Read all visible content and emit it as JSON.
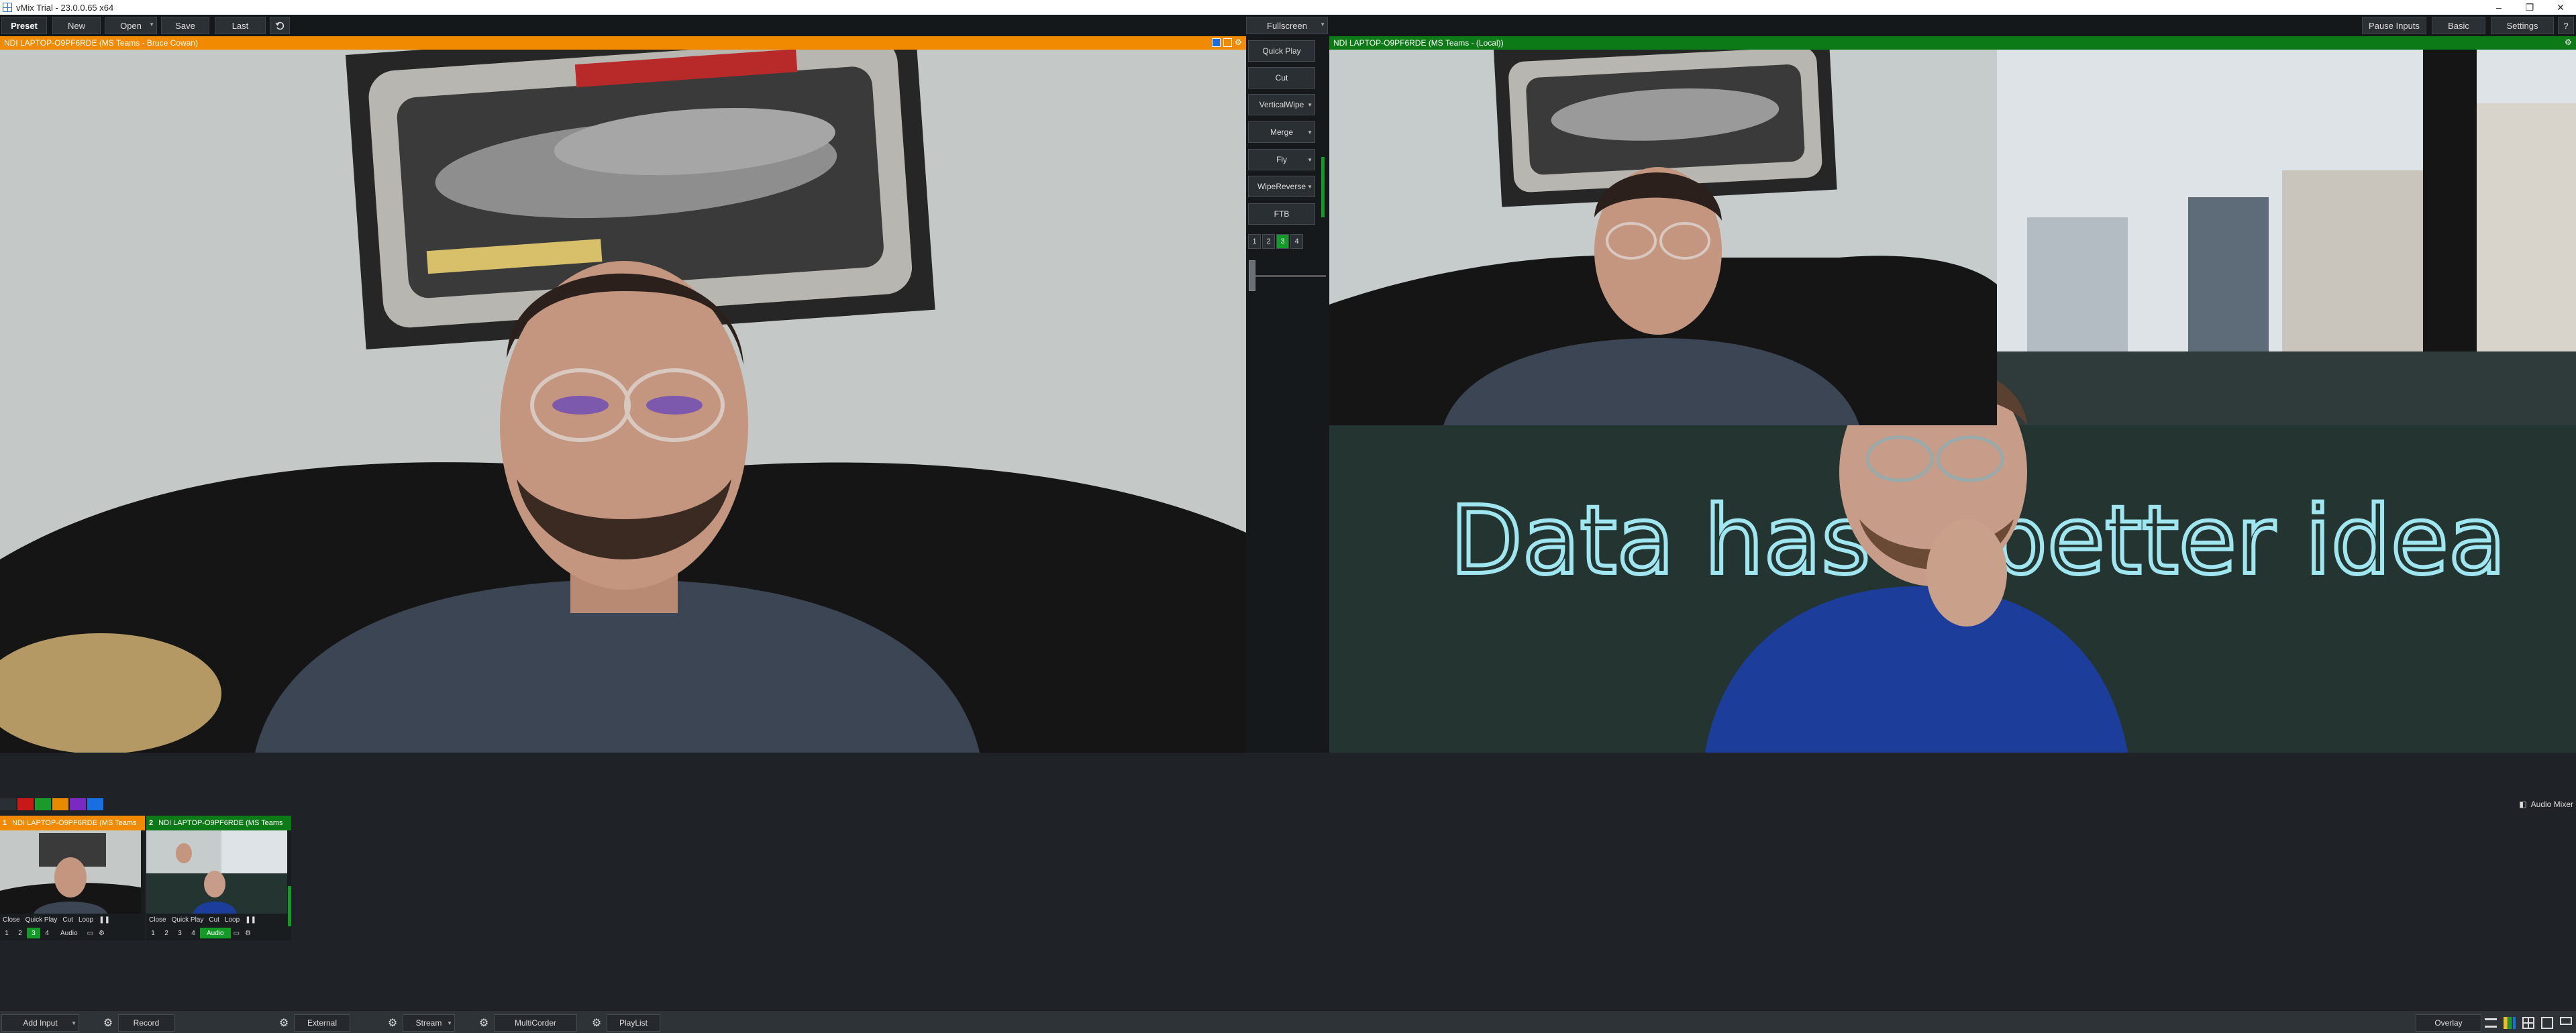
{
  "window": {
    "title": "vMix Trial - 23.0.0.65 x64",
    "minimize": "–",
    "maximize": "❐",
    "close": "✕"
  },
  "toolbar": {
    "preset": "Preset",
    "new": "New",
    "open": "Open",
    "save": "Save",
    "last": "Last",
    "undo_icon": "undo-icon",
    "fullscreen": "Fullscreen",
    "pause_inputs": "Pause Inputs",
    "basic": "Basic",
    "settings": "Settings",
    "help": "?"
  },
  "preview": {
    "title": "NDI LAPTOP-O9PF6RDE (MS Teams - Bruce Cowan)",
    "accent": "#f28a00"
  },
  "program": {
    "title": "NDI LAPTOP-O9PF6RDE (MS Teams - (Local))",
    "accent": "#0c7a16",
    "neon_text": "Data has a better idea"
  },
  "transitions": {
    "quick_play": "Quick Play",
    "cut": "Cut",
    "t1": "VerticalWipe",
    "t2": "Merge",
    "t3": "Fly",
    "t4": "WipeReverse",
    "ftb": "FTB",
    "numbers": [
      "1",
      "2",
      "3",
      "4"
    ],
    "active_number": "3"
  },
  "color_tags": [
    "#c81818",
    "#1a9a2a",
    "#e88a00",
    "#7a2ac0",
    "#1a6fe0",
    "#1aa0e8"
  ],
  "inputs": [
    {
      "number": "1",
      "title": "NDI LAPTOP-O9PF6RDE (MS Teams",
      "state": "preview",
      "close": "Close",
      "quick_play": "Quick Play",
      "cut": "Cut",
      "loop": "Loop",
      "n1": "1",
      "n2": "2",
      "n3": "3",
      "n4": "4",
      "audio": "Audio",
      "active_number": "3"
    },
    {
      "number": "2",
      "title": "NDI LAPTOP-O9PF6RDE (MS Teams",
      "state": "program",
      "close": "Close",
      "quick_play": "Quick Play",
      "cut": "Cut",
      "loop": "Loop",
      "n1": "1",
      "n2": "2",
      "n3": "3",
      "n4": "4",
      "audio": "Audio",
      "audio_on": true
    }
  ],
  "audio_mixer": "Audio Mixer",
  "bottombar": {
    "add_input": "Add Input",
    "record": "Record",
    "external": "External",
    "stream": "Stream",
    "multicorder": "MultiCorder",
    "playlist": "PlayList",
    "overlay": "Overlay"
  }
}
